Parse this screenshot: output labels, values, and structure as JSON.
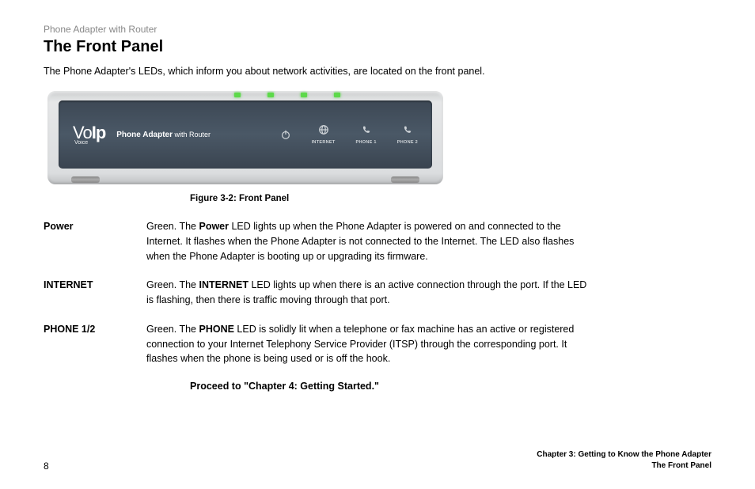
{
  "header": {
    "product": "Phone Adapter with Router",
    "title": "The Front Panel",
    "intro": "The Phone Adapter's LEDs, which inform you about network activities, are located on the front panel."
  },
  "device": {
    "logo_main_a": "Vo",
    "logo_main_b": "Ip",
    "logo_sub": "Voice",
    "label_bold": "Phone Adapter",
    "label_light": " with Router",
    "indicators": {
      "power": "",
      "internet": "INTERNET",
      "phone1": "PHONE 1",
      "phone2": "PHONE 2"
    }
  },
  "caption": "Figure 3-2: Front Panel",
  "rows": {
    "power": {
      "label": "Power",
      "pre": "Green. The ",
      "bold": "Power",
      "post": " LED lights up when the Phone Adapter is powered on and connected to the Internet. It flashes when the Phone Adapter is not connected to the Internet. The LED also flashes when the Phone Adapter is booting up or upgrading its firmware."
    },
    "internet": {
      "label": "INTERNET",
      "pre": "Green. The ",
      "bold": "INTERNET",
      "post": " LED lights up when there is an active connection through the port. If the LED is flashing, then there is traffic moving through that port."
    },
    "phone": {
      "label": "PHONE 1/2",
      "pre": "Green. The ",
      "bold": "PHONE",
      "post": " LED is solidly lit when a telephone or fax machine has an active or registered connection to your Internet Telephony Service Provider (ITSP) through the corresponding port. It flashes when the phone is being used or is off the hook."
    }
  },
  "proceed": "Proceed to \"Chapter 4: Getting Started.\"",
  "footer": {
    "page": "8",
    "chapter": "Chapter 3: Getting to Know the Phone Adapter",
    "section": "The Front Panel"
  }
}
